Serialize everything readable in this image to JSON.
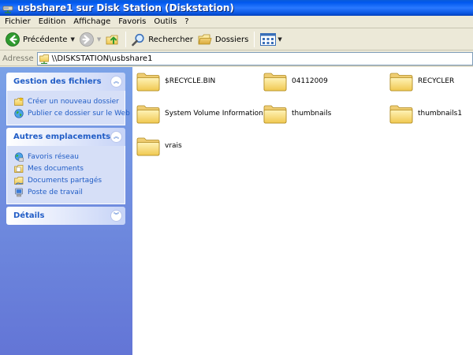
{
  "window": {
    "title": "usbshare1 sur Disk Station (Diskstation)"
  },
  "menu": [
    "Fichier",
    "Edition",
    "Affichage",
    "Favoris",
    "Outils",
    "?"
  ],
  "toolbar": {
    "back_label": "Précédente",
    "search_label": "Rechercher",
    "folders_label": "Dossiers"
  },
  "address": {
    "label": "Adresse",
    "value": "\\\\DISKSTATION\\usbshare1"
  },
  "taskpane": {
    "file_tasks": {
      "title": "Gestion des fichiers",
      "items": [
        "Créer un nouveau dossier",
        "Publier ce dossier sur le Web"
      ]
    },
    "other_places": {
      "title": "Autres emplacements",
      "items": [
        "Favoris réseau",
        "Mes documents",
        "Documents partagés",
        "Poste de travail"
      ]
    },
    "details": {
      "title": "Détails"
    }
  },
  "folders": [
    "$RECYCLE.BIN",
    "04112009",
    "RECYCLER",
    "System Volume Information",
    "thumbnails",
    "thumbnails1",
    "vrais"
  ]
}
